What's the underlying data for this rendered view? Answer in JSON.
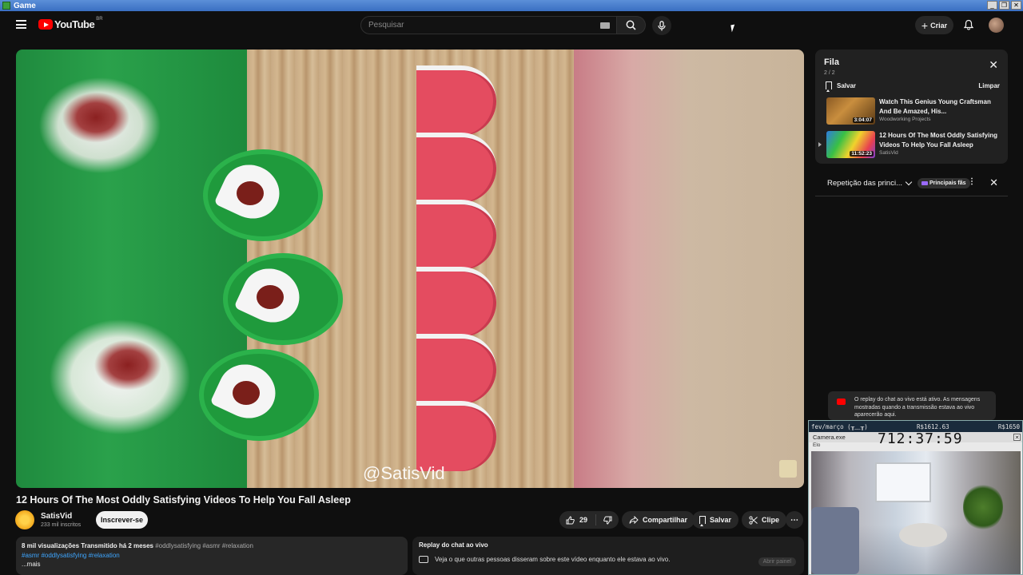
{
  "window": {
    "title": "Game"
  },
  "header": {
    "logo_text": "YouTube",
    "country_code": "BR",
    "search_placeholder": "Pesquisar",
    "create_label": "Criar"
  },
  "video": {
    "watermark": "@SatisVid",
    "title": "12 Hours Of The Most Oddly Satisfying Videos To Help You Fall Asleep",
    "channel": "SatisVid",
    "subscribers": "233 mil inscritos",
    "subscribe_label": "Inscrever-se",
    "likes": "29",
    "share_label": "Compartilhar",
    "save_label": "Salvar",
    "clip_label": "Clipe"
  },
  "description": {
    "views_info": "8 mil visualizações  Transmitido há 2 meses",
    "tags": "#oddlysatisfying #asmr #relaxation",
    "links": "#asmr #oddlysatisfying #relaxation",
    "more_label": "...mais"
  },
  "replay_box": {
    "title": "Replay do chat ao vivo",
    "text": "Veja o que outras pessoas disseram sobre este vídeo enquanto ele estava ao vivo.",
    "open_label": "Abrir painel"
  },
  "queue": {
    "title": "Fila",
    "count": "2 / 2",
    "save_label": "Salvar",
    "clear_label": "Limpar",
    "items": [
      {
        "title": "Watch This Genius Young Craftsman And Be Amazed, His...",
        "channel": "Woodworking Projects",
        "duration": "3:04:07"
      },
      {
        "title": "12 Hours Of The Most Oddly Satisfying Videos To Help You Fall Asleep",
        "channel": "SatisVid",
        "duration": "11:52:23"
      }
    ]
  },
  "chat": {
    "title": "Repetição das princi...",
    "fans_label": "Principais fãs",
    "notice": "O replay do chat ao vivo está ativo. As mensagens mostradas quando a transmissão estava ao vivo aparecerão aqui."
  },
  "overlay": {
    "strip_left": "fev/março (╥﹏╥)",
    "strip_mid": "R$1612.63",
    "strip_right": "R$1650",
    "app_name": "Camera.exe",
    "clock": "712:37:59",
    "menu": "Elo"
  }
}
